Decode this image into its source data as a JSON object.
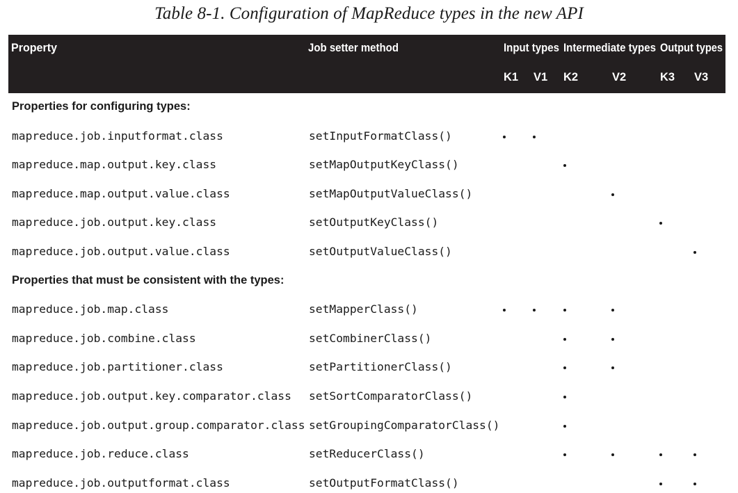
{
  "caption": "Table 8-1. Configuration of MapReduce types in the new API",
  "header": {
    "property": "Property",
    "setter": "Job setter method",
    "groups": [
      "Input types",
      "Intermediate types",
      "Output types"
    ],
    "columns": [
      "K1",
      "V1",
      "K2",
      "V2",
      "K3",
      "V3"
    ]
  },
  "sections": [
    {
      "title": "Properties for configuring types:",
      "rows": [
        {
          "property": "mapreduce.job.inputformat.class",
          "setter": "setInputFormatClass()",
          "marks": [
            true,
            true,
            false,
            false,
            false,
            false
          ]
        },
        {
          "property": "mapreduce.map.output.key.class",
          "setter": "setMapOutputKeyClass()",
          "marks": [
            false,
            false,
            true,
            false,
            false,
            false
          ]
        },
        {
          "property": "mapreduce.map.output.value.class",
          "setter": "setMapOutputValueClass()",
          "marks": [
            false,
            false,
            false,
            true,
            false,
            false
          ]
        },
        {
          "property": "mapreduce.job.output.key.class",
          "setter": "setOutputKeyClass()",
          "marks": [
            false,
            false,
            false,
            false,
            true,
            false
          ]
        },
        {
          "property": "mapreduce.job.output.value.class",
          "setter": "setOutputValueClass()",
          "marks": [
            false,
            false,
            false,
            false,
            false,
            true
          ]
        }
      ]
    },
    {
      "title": "Properties that must be consistent with the types:",
      "rows": [
        {
          "property": "mapreduce.job.map.class",
          "setter": "setMapperClass()",
          "marks": [
            true,
            true,
            true,
            true,
            false,
            false
          ]
        },
        {
          "property": "mapreduce.job.combine.class",
          "setter": "setCombinerClass()",
          "marks": [
            false,
            false,
            true,
            true,
            false,
            false
          ]
        },
        {
          "property": "mapreduce.job.partitioner.class",
          "setter": "setPartitionerClass()",
          "marks": [
            false,
            false,
            true,
            true,
            false,
            false
          ]
        },
        {
          "property": "mapreduce.job.output.key.comparator.class",
          "setter": "setSortComparatorClass()",
          "marks": [
            false,
            false,
            true,
            false,
            false,
            false
          ]
        },
        {
          "property": "mapreduce.job.output.group.comparator.class",
          "setter": "setGroupingComparatorClass()",
          "marks": [
            false,
            false,
            true,
            false,
            false,
            false
          ]
        },
        {
          "property": "mapreduce.job.reduce.class",
          "setter": "setReducerClass()",
          "marks": [
            false,
            false,
            true,
            true,
            true,
            true
          ]
        },
        {
          "property": "mapreduce.job.outputformat.class",
          "setter": "setOutputFormatClass()",
          "marks": [
            false,
            false,
            false,
            false,
            true,
            true
          ]
        }
      ]
    }
  ]
}
